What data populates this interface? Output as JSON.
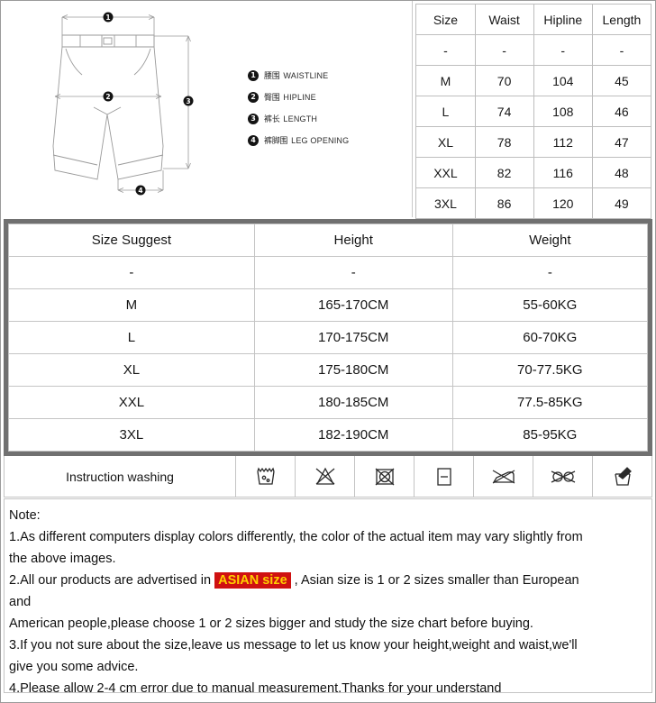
{
  "diagram": {
    "title": "mens-shorts-measurement-diagram",
    "markers": [
      "1",
      "2",
      "3",
      "4"
    ],
    "legend": [
      {
        "num": "1",
        "cn": "腰围",
        "en": "WAISTLINE"
      },
      {
        "num": "2",
        "cn": "臀围",
        "en": "HIPLINE"
      },
      {
        "num": "3",
        "cn": "裤长",
        "en": "LENGTH"
      },
      {
        "num": "4",
        "cn": "裤脚围",
        "en": "LEG OPENING"
      }
    ]
  },
  "size_table": {
    "headers": [
      "Size",
      "Waist",
      "Hipline",
      "Length"
    ],
    "rows": [
      [
        "-",
        "-",
        "-",
        "-"
      ],
      [
        "M",
        "70",
        "104",
        "45"
      ],
      [
        "L",
        "74",
        "108",
        "46"
      ],
      [
        "XL",
        "78",
        "112",
        "47"
      ],
      [
        "XXL",
        "82",
        "116",
        "48"
      ],
      [
        "3XL",
        "86",
        "120",
        "49"
      ]
    ]
  },
  "suggest_table": {
    "headers": [
      "Size Suggest",
      "Height",
      "Weight"
    ],
    "rows": [
      [
        "-",
        "-",
        "-"
      ],
      [
        "M",
        "165-170CM",
        "55-60KG"
      ],
      [
        "L",
        "170-175CM",
        "60-70KG"
      ],
      [
        "XL",
        "175-180CM",
        "70-77.5KG"
      ],
      [
        "XXL",
        "180-185CM",
        "77.5-85KG"
      ],
      [
        "3XL",
        "182-190CM",
        "85-95KG"
      ]
    ]
  },
  "washing": {
    "label": "Instruction washing",
    "icons": [
      "machine-wash-icon",
      "do-not-bleach-icon",
      "do-not-tumble-dry-icon",
      "dry-flat-icon",
      "do-not-iron-icon",
      "do-not-dry-clean-icon",
      "hand-wash-icon"
    ]
  },
  "note": {
    "heading": "Note:",
    "line1a": "1.As different computers display colors differently, the color of the actual item may vary slightly from",
    "line1b": "the above images.",
    "line2a": "2.All our products are advertised in ",
    "line2_highlight": "ASIAN size",
    "line2b": " , Asian size is 1 or 2 sizes smaller than European",
    "line2c": "and",
    "line2d": "American people,please choose 1 or 2 sizes bigger and study the size chart before buying.",
    "line3a": "3.If you not sure about the size,leave us message to let us know your height,weight and waist,we'll",
    "line3b": "give you some advice.",
    "line4": "4.Please allow 2-4 cm error due to manual measurement.Thanks for your understand"
  },
  "colors": {
    "highlight_bg": "#cf1111",
    "highlight_fg": "#ffcf00",
    "table_border": "#c4c4c4",
    "thick_border": "#707070"
  }
}
